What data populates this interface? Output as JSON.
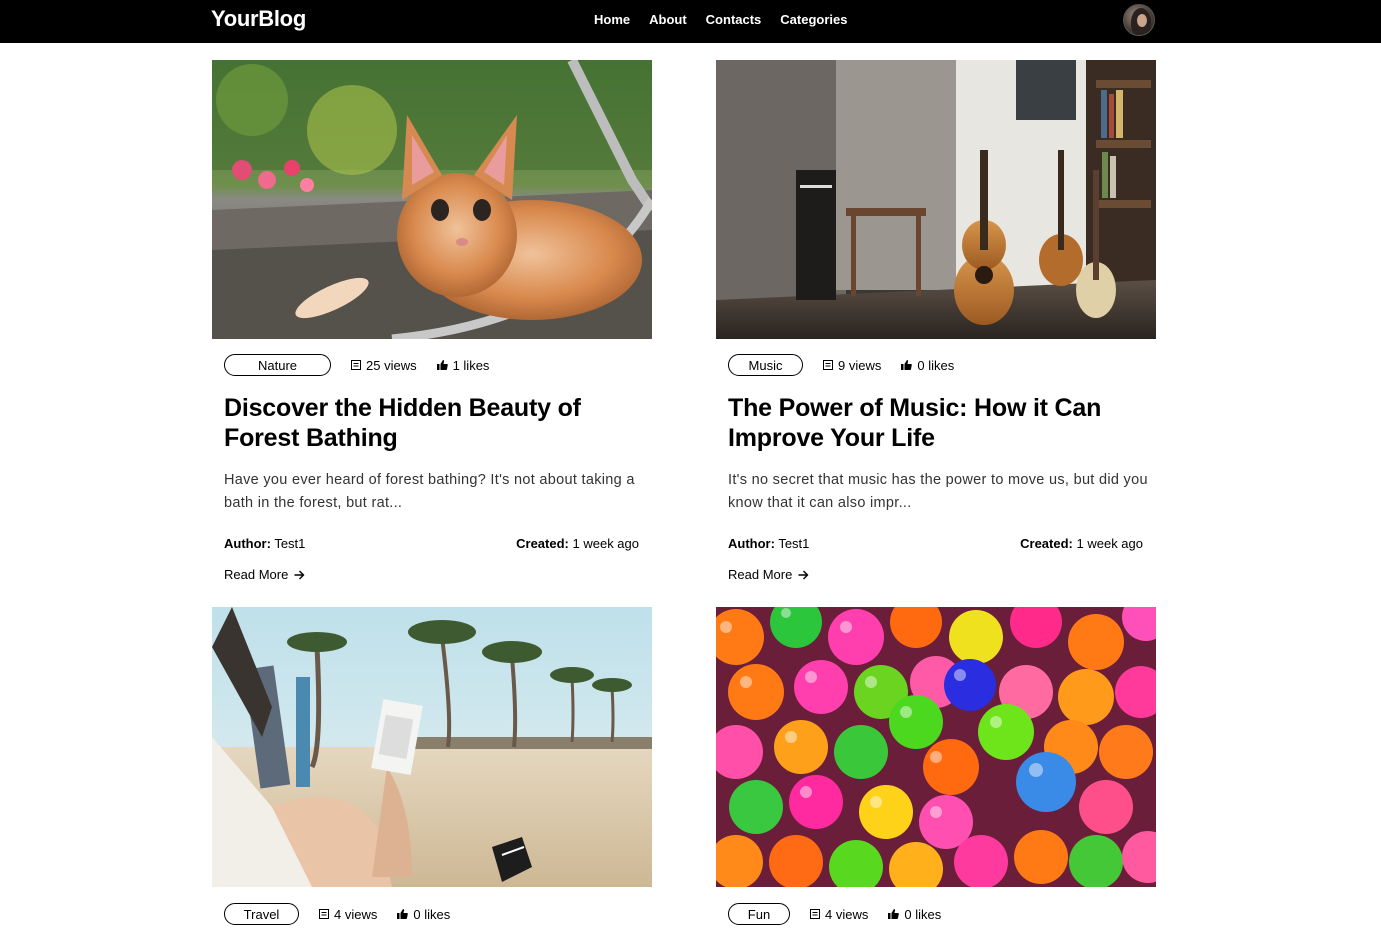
{
  "header": {
    "brand": "YourBlog",
    "nav": [
      "Home",
      "About",
      "Contacts",
      "Categories"
    ]
  },
  "posts": [
    {
      "category": "Nature",
      "views": "25 views",
      "likes": "1 likes",
      "title": "Discover the Hidden Beauty of Forest Bathing",
      "excerpt": "Have you ever heard of forest bathing? It's not about taking a bath in the forest, but rat...",
      "author_label": "Author:",
      "author": "Test1",
      "created_label": "Created:",
      "created": "1 week ago",
      "read_more": "Read More"
    },
    {
      "category": "Music",
      "views": "9 views",
      "likes": "0 likes",
      "title": "The Power of Music: How it Can Improve Your Life",
      "excerpt": "It's no secret that music has the power to move us, but did you know that it can also impr...",
      "author_label": "Author:",
      "author": "Test1",
      "created_label": "Created:",
      "created": "1 week ago",
      "read_more": "Read More"
    },
    {
      "category": "Travel",
      "views": "4 views",
      "likes": "0 likes"
    },
    {
      "category": "Fun",
      "views": "4 views",
      "likes": "0 likes"
    }
  ],
  "icons": {
    "views": "eye-box-icon",
    "likes": "thumbs-up-icon",
    "read_more": "arrow-right-icon"
  }
}
